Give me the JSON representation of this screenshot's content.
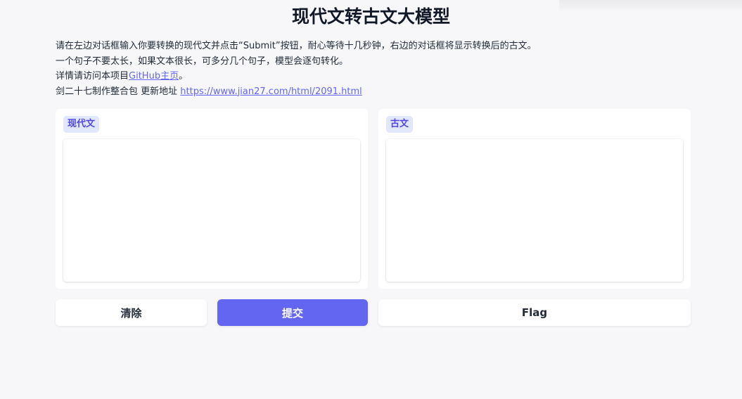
{
  "header": {
    "title": "现代文转古文大模型"
  },
  "description": {
    "line1": "请在左边对话框输入你要转换的现代文并点击“Submit”按钮，耐心等待十几秒钟，右边的对话框将显示转换后的古文。",
    "line2": "一个句子不要太长，如果文本很长，可多分几个句子，模型会逐句转化。",
    "line3_prefix": "详情请访问本项目",
    "line3_link": "GitHub主页",
    "line3_suffix": "。",
    "line4_prefix": "剑二十七制作整合包 更新地址 ",
    "line4_link": "https://www.jian27.com/html/2091.html"
  },
  "input_panel": {
    "label": "现代文",
    "value": ""
  },
  "output_panel": {
    "label": "古文",
    "value": ""
  },
  "buttons": {
    "clear_label": "清除",
    "submit_label": "提交",
    "flag_label": "Flag"
  },
  "colors": {
    "accent": "#6366f1",
    "badge_bg": "#e0e7ff",
    "badge_text": "#4f46e5",
    "background": "#f7f7f9"
  }
}
